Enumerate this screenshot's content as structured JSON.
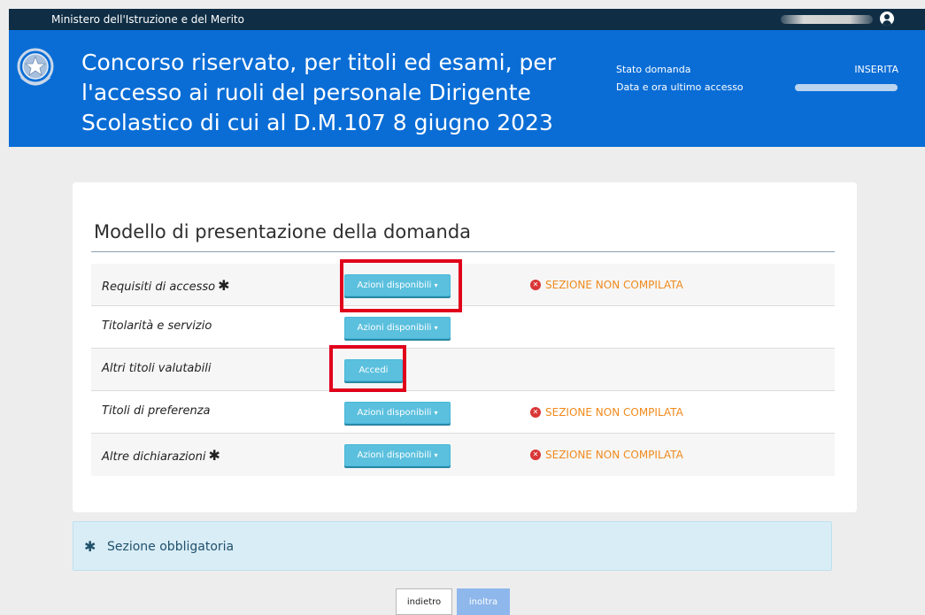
{
  "topbar": {
    "ministry": "Ministero dell'Istruzione e del Merito",
    "user_icon": "user-circle-icon"
  },
  "header": {
    "emblem_icon": "emblem-icon",
    "title": "Concorso riservato, per titoli ed esami, per l'accesso ai ruoli del personale Dirigente Scolastico di cui al D.M.107 8 giugno 2023",
    "stato_label": "Stato domanda",
    "stato_value": "INSERITA",
    "data_label": "Data e ora ultimo accesso"
  },
  "card": {
    "title": "Modello di presentazione della domanda",
    "rows": [
      {
        "label": "Requisiti di accesso",
        "asterisk": "✱",
        "action": "Azioni disponibili",
        "status": "SEZIONE NON COMPILATA"
      },
      {
        "label": "Titolarità e servizio",
        "action": "Azioni disponibili"
      },
      {
        "label": "Altri titoli valutabili",
        "action": "Accedi"
      },
      {
        "label": "Titoli di preferenza",
        "action": "Azioni disponibili",
        "status": "SEZIONE NON COMPILATA"
      },
      {
        "label": "Altre dichiarazioni",
        "asterisk": "✱",
        "action": "Azioni disponibili",
        "status": "SEZIONE NON COMPILATA"
      }
    ]
  },
  "alert": {
    "icon": "✱",
    "text": "Sezione obbligatoria"
  },
  "buttons": {
    "back": "indietro",
    "submit": "inoltra"
  },
  "colors": {
    "topbar": "#0f2e45",
    "header": "#0a6dd6",
    "action_button": "#5bc0de",
    "status_warning": "#f08a1c",
    "status_icon": "#d93636",
    "highlight": "#e0001b",
    "alert_bg": "#d9edf7"
  }
}
